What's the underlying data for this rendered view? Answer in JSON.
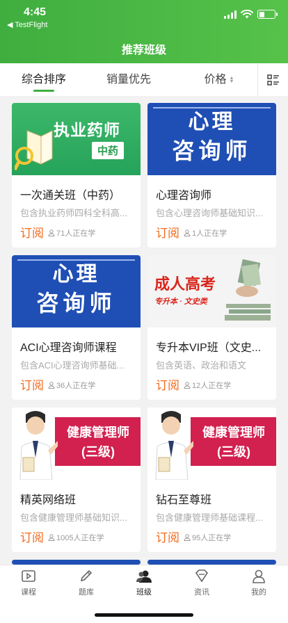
{
  "status_bar": {
    "time": "4:45",
    "back_app": "◀ TestFlight",
    "battery_level": 0.3
  },
  "header": {
    "title": "推荐班级"
  },
  "sort_tabs": {
    "comprehensive": "综合排序",
    "sales": "销量优先",
    "price": "价格"
  },
  "icons": {
    "layout_toggle": "list-grid-icon",
    "person": "person-icon"
  },
  "cards": [
    {
      "title": "一次通关班（中药）",
      "desc": "包含执业药师四科全科高...",
      "subscribe": "订阅",
      "learners": "71人正在学",
      "cover_line1": "执业药师",
      "cover_line2": "中药"
    },
    {
      "title": "心理咨询师",
      "desc": "包含心理咨询师基础知识...",
      "subscribe": "订阅",
      "learners": "1人正在学",
      "cover_line1": "心理",
      "cover_line2": "咨询师"
    },
    {
      "title": "ACI心理咨询师课程",
      "desc": "包含ACI心理咨询师基础...",
      "subscribe": "订阅",
      "learners": "36人正在学",
      "cover_line1": "心理",
      "cover_line2": "咨询师"
    },
    {
      "title": "专升本VIP班（文史...",
      "desc": "包含英语、政治和语文",
      "subscribe": "订阅",
      "learners": "12人正在学",
      "cover_line1": "成人高考",
      "cover_line2": "专升本 · 文史类"
    },
    {
      "title": "精英网络班",
      "desc": "包含健康管理师基础知识...",
      "subscribe": "订阅",
      "learners": "1005人正在学",
      "cover_line1": "健康管理师",
      "cover_line2": "(三级)"
    },
    {
      "title": "钻石至尊班",
      "desc": "包含健康管理师基础课程...",
      "subscribe": "订阅",
      "learners": "95人正在学",
      "cover_line1": "健康管理师",
      "cover_line2": "(三级)"
    }
  ],
  "tabbar": {
    "items": [
      {
        "label": "课程",
        "icon": "video-icon"
      },
      {
        "label": "题库",
        "icon": "pencil-icon"
      },
      {
        "label": "班级",
        "icon": "people-icon"
      },
      {
        "label": "资讯",
        "icon": "diamond-icon"
      },
      {
        "label": "我的",
        "icon": "user-icon"
      }
    ],
    "active_index": 2
  },
  "colors": {
    "brand_green": "#3fae3f",
    "subscribe_orange": "#f06a1d",
    "cover_blue": "#1f4fb5",
    "cover_red": "#d2204f"
  }
}
